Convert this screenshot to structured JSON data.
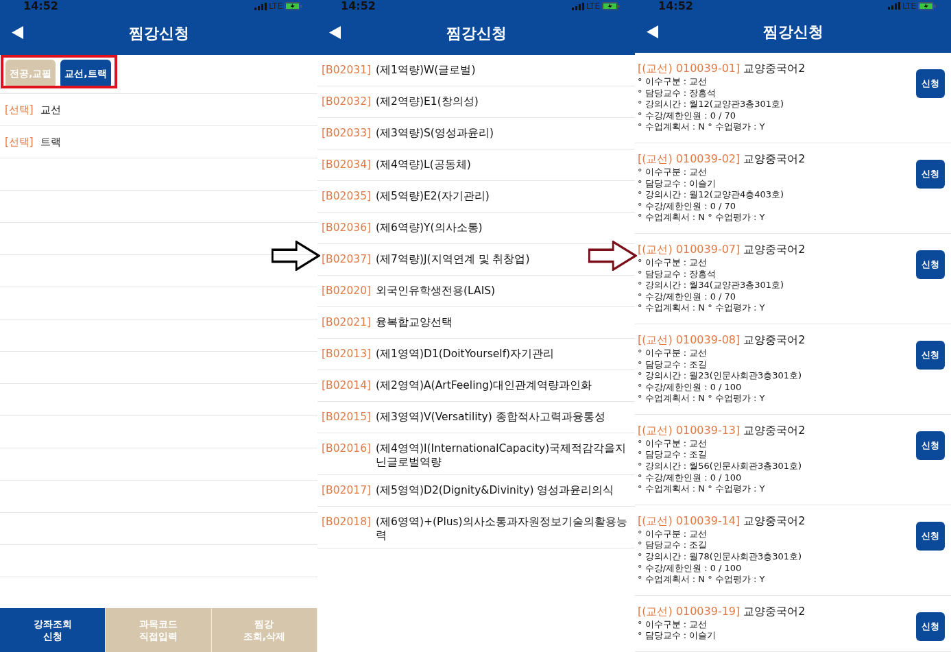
{
  "screens": [
    {
      "kind": "categories",
      "status_bar": {
        "time": "14:52",
        "network": "LTE"
      },
      "title": "찜강신청",
      "tabs": [
        {
          "label": "전공,교필",
          "selected": false
        },
        {
          "label": "교선,트랙",
          "selected": true
        }
      ],
      "rows": [
        {
          "tag": "[선택]",
          "label": "교선"
        },
        {
          "tag": "[선택]",
          "label": "트랙"
        }
      ],
      "bottom_nav": [
        {
          "label": "강좌조회\n신청",
          "selected": true
        },
        {
          "label": "과목코드\n직접입력",
          "selected": false
        },
        {
          "label": "찜강\n조회,삭제",
          "selected": false
        }
      ]
    },
    {
      "kind": "subjects",
      "status_bar": {
        "time": "14:52",
        "network": "LTE"
      },
      "title": "찜강신청",
      "rows": [
        {
          "code": "[B02031]",
          "name": "(제1역량)W(글로벌)"
        },
        {
          "code": "[B02032]",
          "name": "(제2역량)E1(창의성)"
        },
        {
          "code": "[B02033]",
          "name": "(제3역량)S(영성과윤리)"
        },
        {
          "code": "[B02034]",
          "name": "(제4역량)L(공동체)"
        },
        {
          "code": "[B02035]",
          "name": "(제5역량)E2(자기관리)"
        },
        {
          "code": "[B02036]",
          "name": "(제6역량)Y(의사소통)"
        },
        {
          "code": "[B02037]",
          "name": "(제7역량)J(지역연계 및 취창업)"
        },
        {
          "code": "[B02020]",
          "name": "외국인유학생전용(LAIS)"
        },
        {
          "code": "[B02021]",
          "name": "융복합교양선택"
        },
        {
          "code": "[B02013]",
          "name": "(제1영역)D1(DoitYourself)자기관리"
        },
        {
          "code": "[B02014]",
          "name": "(제2영역)A(ArtFeeling)대인관계역량과인화"
        },
        {
          "code": "[B02015]",
          "name": "(제3영역)V(Versatility) 종합적사고력과융통성"
        },
        {
          "code": "[B02016]",
          "name": "(제4영역)I(InternationalCapacity)국제적감각을지닌글로벌역량"
        },
        {
          "code": "[B02017]",
          "name": "(제5영역)D2(Dignity&Divinity) 영성과윤리의식"
        },
        {
          "code": "[B02018]",
          "name": "(제6영역)+(Plus)의사소통과자원정보기술의활용능력"
        }
      ]
    },
    {
      "kind": "courses",
      "status_bar": {
        "time": "14:52",
        "network": "LTE"
      },
      "title": "찜강신청",
      "courses": [
        {
          "code": "[(교선) 010039-01]",
          "name": "교양중국어2",
          "details": [
            "° 이수구분 : 교선",
            "° 담당교수 : 장흥석",
            "° 강의시간 : 월12(교양관3층301호)",
            "° 수강/제한인원 : 0 / 70",
            "° 수업계획서 : N ° 수업평가 : Y"
          ],
          "button": "신청"
        },
        {
          "code": "[(교선) 010039-02]",
          "name": "교양중국어2",
          "details": [
            "° 이수구분 : 교선",
            "° 담당교수 : 이슬기",
            "° 강의시간 : 월12(교양관4층403호)",
            "° 수강/제한인원 : 0 / 70",
            "° 수업계획서 : N ° 수업평가 : Y"
          ],
          "button": "신청"
        },
        {
          "code": "[(교선) 010039-07]",
          "name": "교양중국어2",
          "details": [
            "° 이수구분 : 교선",
            "° 담당교수 : 장흥석",
            "° 강의시간 : 월34(교양관3층301호)",
            "° 수강/제한인원 : 0 / 70",
            "° 수업계획서 : N ° 수업평가 : Y"
          ],
          "button": "신청"
        },
        {
          "code": "[(교선) 010039-08]",
          "name": "교양중국어2",
          "details": [
            "° 이수구분 : 교선",
            "° 담당교수 : 조길",
            "° 강의시간 : 월23(인문사회관3층301호)",
            "° 수강/제한인원 : 0 / 100",
            "° 수업계획서 : N ° 수업평가 : Y"
          ],
          "button": "신청"
        },
        {
          "code": "[(교선) 010039-13]",
          "name": "교양중국어2",
          "details": [
            "° 이수구분 : 교선",
            "° 담당교수 : 조길",
            "° 강의시간 : 월56(인문사회관3층301호)",
            "° 수강/제한인원 : 0 / 100",
            "° 수업계획서 : N ° 수업평가 : Y"
          ],
          "button": "신청"
        },
        {
          "code": "[(교선) 010039-14]",
          "name": "교양중국어2",
          "details": [
            "° 이수구분 : 교선",
            "° 담당교수 : 조길",
            "° 강의시간 : 월78(인문사회관3층301호)",
            "° 수강/제한인원 : 0 / 100",
            "° 수업계획서 : N ° 수업평가 : Y"
          ],
          "button": "신청"
        },
        {
          "code": "[(교선) 010039-19]",
          "name": "교양중국어2",
          "details": [
            "° 이수구분 : 교선",
            "° 담당교수 : 이슬기"
          ],
          "button": "신청"
        }
      ]
    }
  ],
  "annotations": [
    {
      "kind": "frame",
      "color": "#e0101c"
    },
    {
      "kind": "arrow",
      "color": "#000000"
    },
    {
      "kind": "arrow",
      "color": "#7a0f1a"
    }
  ]
}
